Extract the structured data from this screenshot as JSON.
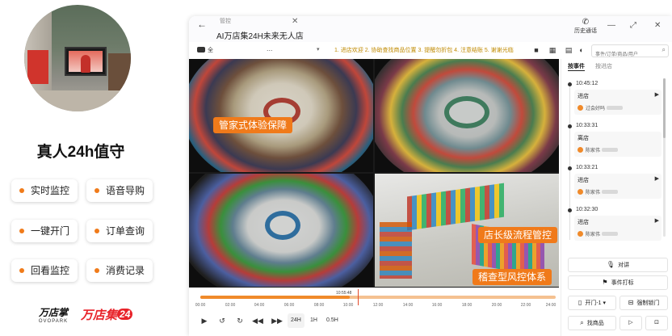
{
  "promo": {
    "headline": "真人24h值守",
    "features": [
      "实时监控",
      "语音导购",
      "一键开门",
      "订单查询",
      "回看监控",
      "消费记录"
    ],
    "logo_wandianzhang": "万店掌",
    "logo_wandianzhang_en": "OVOPARK",
    "logo_wandianji": "万店集",
    "logo_wandianji_num": "24"
  },
  "app": {
    "back_icon": "arrow-left-icon",
    "tab_small": "管控",
    "title": "AI万店集24H未来无人店",
    "history_label": "历史通话"
  },
  "toolbar": {
    "shop_value": "全",
    "shop_dots": "...",
    "marquee": "1. 进店欢迎 2. 协助查找商品位置 3. 提醒勿折包 4. 注意结账 5. 谢谢光临",
    "search_placeholder": "事件/订单/商品/用户"
  },
  "video": {
    "badges": [
      "管家式体验保障",
      "店长级流程管控",
      "稽查型风控体系"
    ]
  },
  "timeline": {
    "current": "10:55:48",
    "ticks": [
      "00:00",
      "02:00",
      "04:00",
      "06:00",
      "08:00",
      "10:00",
      "12:00",
      "14:00",
      "16:00",
      "18:00",
      "20:00",
      "22:00",
      "24:00"
    ],
    "progress": 0.42,
    "speeds": [
      "24H",
      "1H",
      "0.5H"
    ]
  },
  "panel": {
    "tabs": [
      "按事件",
      "按进店"
    ],
    "events": [
      {
        "time": "10:45:12",
        "type": "进店",
        "user": "过会好吗"
      },
      {
        "time": "10:33:31",
        "type": "离店",
        "user": "陈家伟"
      },
      {
        "time": "10:33:21",
        "type": "进店",
        "user": "陈家伟"
      },
      {
        "time": "10:32:30",
        "type": "进店",
        "user": "陈家伟"
      }
    ],
    "buttons": {
      "talk": "对讲",
      "mark": "事件打标",
      "door": "开门-1",
      "force_door": "强制锁门",
      "find_goods": "找商品"
    }
  },
  "colors": {
    "accent_orange": "#f07a1a",
    "marquee_text": "#c08a00",
    "brand_red": "#e8232a"
  }
}
